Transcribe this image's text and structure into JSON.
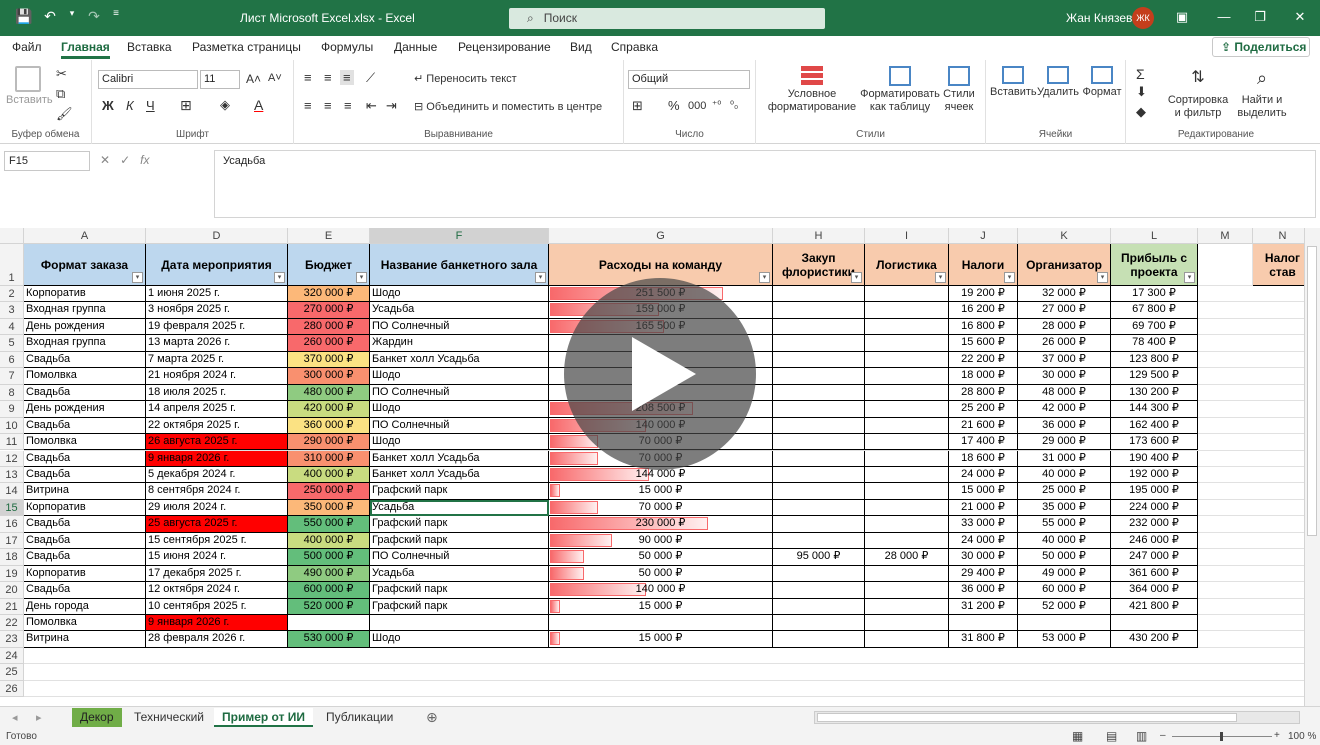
{
  "titlebar": {
    "doc_title": "Лист Microsoft Excel.xlsx  -  Excel",
    "search_placeholder": "Поиск",
    "user_name": "Жан Князев",
    "avatar_initials": "ЖК"
  },
  "menu": {
    "tabs": [
      "Файл",
      "Главная",
      "Вставка",
      "Разметка страницы",
      "Формулы",
      "Данные",
      "Рецензирование",
      "Вид",
      "Справка"
    ],
    "share": "Поделиться"
  },
  "ribbon": {
    "paste": "Вставить",
    "clipboard_label": "Буфер обмена",
    "font_name": "Calibri",
    "font_size": "11",
    "font_label": "Шрифт",
    "bold": "Ж",
    "italic": "К",
    "underline": "Ч",
    "wrap_text": "Переносить текст",
    "merge_center": "Объединить и поместить в центре",
    "alignment_label": "Выравнивание",
    "number_format": "Общий",
    "number_label": "Число",
    "cond_format_1": "Условное",
    "cond_format_2": "форматирование",
    "format_table_1": "Форматировать",
    "format_table_2": "как таблицу",
    "cell_styles_1": "Стили",
    "cell_styles_2": "ячеек",
    "styles_label": "Стили",
    "insert": "Вставить",
    "delete": "Удалить",
    "format": "Формат",
    "cells_label": "Ячейки",
    "sort_1": "Сортировка",
    "sort_2": "и фильтр",
    "find_1": "Найти и",
    "find_2": "выделить",
    "editing_label": "Редактирование"
  },
  "formula_bar": {
    "name_box": "F15",
    "fx": "fx",
    "value": "Усадьба"
  },
  "sheet": {
    "columns": [
      "A",
      "D",
      "E",
      "F",
      "G",
      "H",
      "I",
      "J",
      "K",
      "L",
      "M",
      "N"
    ],
    "headers": [
      "Формат заказа",
      "Дата мероприятия",
      "Бюджет",
      "Название банкетного зала",
      "Расходы на команду",
      "Закуп флористики",
      "Логистика",
      "Налоги",
      "Организатор",
      "Прибыль с проекта",
      "",
      "Налог став"
    ],
    "rows": [
      {
        "n": "2",
        "a": "Корпоратив",
        "d": "1 июня 2025 г.",
        "e": "320 000 ₽",
        "f": "Шодо",
        "g": "251 500 ₽",
        "h": "",
        "i": "",
        "j": "19 200 ₽",
        "k": "32 000 ₽",
        "l": "17 300 ₽"
      },
      {
        "n": "3",
        "a": "Входная группа",
        "d": "3 ноября 2025 г.",
        "e": "270 000 ₽",
        "f": "Усадьба",
        "g": "159 000 ₽",
        "h": "",
        "i": "",
        "j": "16 200 ₽",
        "k": "27 000 ₽",
        "l": "67 800 ₽"
      },
      {
        "n": "4",
        "a": "День рождения",
        "d": "19 февраля 2025 г.",
        "e": "280 000 ₽",
        "f": "ПО Солнечный",
        "g": "165 500 ₽",
        "h": "",
        "i": "",
        "j": "16 800 ₽",
        "k": "28 000 ₽",
        "l": "69 700 ₽"
      },
      {
        "n": "5",
        "a": "Входная группа",
        "d": "13 марта 2026 г.",
        "e": "260 000 ₽",
        "f": "Жардин",
        "g": "",
        "h": "",
        "i": "",
        "j": "15 600 ₽",
        "k": "26 000 ₽",
        "l": "78 400 ₽"
      },
      {
        "n": "6",
        "a": "Свадьба",
        "d": "7 марта 2025 г.",
        "e": "370 000 ₽",
        "f": "Банкет холл Усадьба",
        "g": "",
        "h": "",
        "i": "",
        "j": "22 200 ₽",
        "k": "37 000 ₽",
        "l": "123 800 ₽"
      },
      {
        "n": "7",
        "a": "Помолвка",
        "d": "21 ноября 2024 г.",
        "e": "300 000 ₽",
        "f": "Шодо",
        "g": "",
        "h": "",
        "i": "",
        "j": "18 000 ₽",
        "k": "30 000 ₽",
        "l": "129 500 ₽"
      },
      {
        "n": "8",
        "a": "Свадьба",
        "d": "18 июля 2025 г.",
        "e": "480 000 ₽",
        "f": "ПО Солнечный",
        "g": "",
        "h": "",
        "i": "",
        "j": "28 800 ₽",
        "k": "48 000 ₽",
        "l": "130 200 ₽"
      },
      {
        "n": "9",
        "a": "День рождения",
        "d": "14 апреля 2025 г.",
        "e": "420 000 ₽",
        "f": "Шодо",
        "g": "208 500 ₽",
        "h": "",
        "i": "",
        "j": "25 200 ₽",
        "k": "42 000 ₽",
        "l": "144 300 ₽"
      },
      {
        "n": "10",
        "a": "Свадьба",
        "d": "22 октября 2025 г.",
        "e": "360 000 ₽",
        "f": "ПО Солнечный",
        "g": "140 000 ₽",
        "h": "",
        "i": "",
        "j": "21 600 ₽",
        "k": "36 000 ₽",
        "l": "162 400 ₽"
      },
      {
        "n": "11",
        "a": "Помолвка",
        "d": "26 августа 2025 г.",
        "e": "290 000 ₽",
        "f": "Шодо",
        "g": "70 000 ₽",
        "h": "",
        "i": "",
        "j": "17 400 ₽",
        "k": "29 000 ₽",
        "l": "173 600 ₽"
      },
      {
        "n": "12",
        "a": "Свадьба",
        "d": "9 января 2026 г.",
        "e": "310 000 ₽",
        "f": "Банкет холл Усадьба",
        "g": "70 000 ₽",
        "h": "",
        "i": "",
        "j": "18 600 ₽",
        "k": "31 000 ₽",
        "l": "190 400 ₽"
      },
      {
        "n": "13",
        "a": "Свадьба",
        "d": "5 декабря 2024 г.",
        "e": "400 000 ₽",
        "f": "Банкет холл Усадьба",
        "g": "144 000 ₽",
        "h": "",
        "i": "",
        "j": "24 000 ₽",
        "k": "40 000 ₽",
        "l": "192 000 ₽"
      },
      {
        "n": "14",
        "a": "Витрина",
        "d": "8 сентября 2024 г.",
        "e": "250 000 ₽",
        "f": "Графский парк",
        "g": "15 000 ₽",
        "h": "",
        "i": "",
        "j": "15 000 ₽",
        "k": "25 000 ₽",
        "l": "195 000 ₽"
      },
      {
        "n": "15",
        "a": "Корпоратив",
        "d": "29 июля 2024 г.",
        "e": "350 000 ₽",
        "f": "Усадьба",
        "g": "70 000 ₽",
        "h": "",
        "i": "",
        "j": "21 000 ₽",
        "k": "35 000 ₽",
        "l": "224 000 ₽"
      },
      {
        "n": "16",
        "a": "Свадьба",
        "d": "25 августа 2025 г.",
        "e": "550 000 ₽",
        "f": "Графский парк",
        "g": "230 000 ₽",
        "h": "",
        "i": "",
        "j": "33 000 ₽",
        "k": "55 000 ₽",
        "l": "232 000 ₽"
      },
      {
        "n": "17",
        "a": "Свадьба",
        "d": "15 сентября 2025 г.",
        "e": "400 000 ₽",
        "f": "Графский парк",
        "g": "90 000 ₽",
        "h": "",
        "i": "",
        "j": "24 000 ₽",
        "k": "40 000 ₽",
        "l": "246 000 ₽"
      },
      {
        "n": "18",
        "a": "Свадьба",
        "d": "15 июня 2024 г.",
        "e": "500 000 ₽",
        "f": "ПО Солнечный",
        "g": "50 000 ₽",
        "h": "95 000 ₽",
        "i": "28 000 ₽",
        "j": "30 000 ₽",
        "k": "50 000 ₽",
        "l": "247 000 ₽"
      },
      {
        "n": "19",
        "a": "Корпоратив",
        "d": "17 декабря 2025 г.",
        "e": "490 000 ₽",
        "f": "Усадьба",
        "g": "50 000 ₽",
        "h": "",
        "i": "",
        "j": "29 400 ₽",
        "k": "49 000 ₽",
        "l": "361 600 ₽"
      },
      {
        "n": "20",
        "a": "Свадьба",
        "d": "12 октября 2024 г.",
        "e": "600 000 ₽",
        "f": "Графский парк",
        "g": "140 000 ₽",
        "h": "",
        "i": "",
        "j": "36 000 ₽",
        "k": "60 000 ₽",
        "l": "364 000 ₽"
      },
      {
        "n": "21",
        "a": "День города",
        "d": "10 сентября 2025 г.",
        "e": "520 000 ₽",
        "f": "Графский парк",
        "g": "15 000 ₽",
        "h": "",
        "i": "",
        "j": "31 200 ₽",
        "k": "52 000 ₽",
        "l": "421 800 ₽"
      },
      {
        "n": "22",
        "a": "Помолвка",
        "d": "9 января 2026 г.",
        "e": "",
        "f": "",
        "g": "",
        "h": "",
        "i": "",
        "j": "",
        "k": "",
        "l": ""
      },
      {
        "n": "23",
        "a": "Витрина",
        "d": "28 февраля 2026 г.",
        "e": "530 000 ₽",
        "f": "Шодо",
        "g": "15 000 ₽",
        "h": "",
        "i": "",
        "j": "31 800 ₽",
        "k": "53 000 ₽",
        "l": "430 200 ₽"
      }
    ],
    "extra_rows": [
      "24",
      "25",
      "26"
    ]
  },
  "sheet_tabs": [
    "Декор",
    "Технический",
    "Пример от ИИ",
    "Публикации"
  ],
  "status": {
    "ready": "Готово",
    "zoom": "100 %"
  },
  "colors": {
    "accent": "#217346",
    "header_blue": "#bdd7ee",
    "header_orange": "#f8cbad",
    "header_green": "#c6e0b4",
    "red_fill": "#ff0000"
  }
}
